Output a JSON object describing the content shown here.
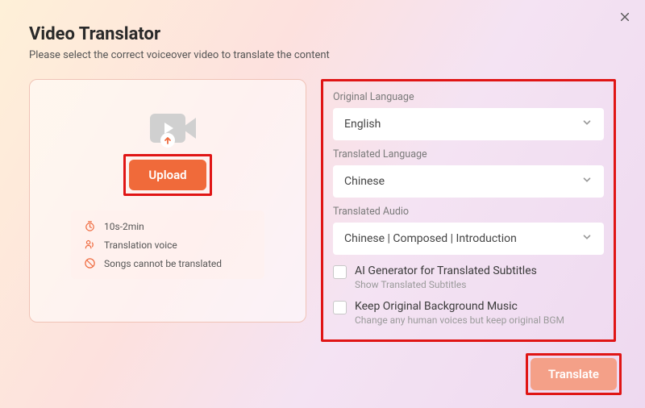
{
  "header": {
    "title": "Video Translator",
    "subtitle": "Please select the correct voiceover video to translate the content"
  },
  "upload": {
    "button": "Upload",
    "hints": {
      "duration": "10s-2min",
      "voice": "Translation voice",
      "songs": "Songs cannot be translated"
    }
  },
  "fields": {
    "original": {
      "label": "Original Language",
      "value": "English"
    },
    "translated": {
      "label": "Translated Language",
      "value": "Chinese"
    },
    "audio": {
      "label": "Translated Audio",
      "value": "Chinese | Composed | Introduction"
    }
  },
  "options": {
    "subtitles": {
      "title": "AI Generator for Translated Subtitles",
      "sub": "Show Translated Subtitles"
    },
    "bgm": {
      "title": "Keep Original Background Music",
      "sub": "Change any human voices but keep original BGM"
    }
  },
  "actions": {
    "translate": "Translate"
  }
}
